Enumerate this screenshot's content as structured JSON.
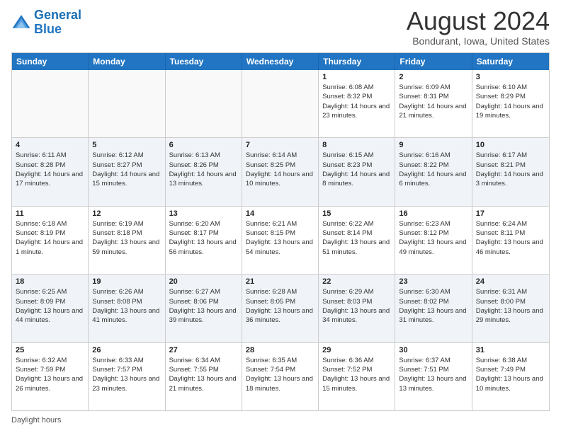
{
  "header": {
    "logo_line1": "General",
    "logo_line2": "Blue",
    "month_title": "August 2024",
    "location": "Bondurant, Iowa, United States"
  },
  "days_of_week": [
    "Sunday",
    "Monday",
    "Tuesday",
    "Wednesday",
    "Thursday",
    "Friday",
    "Saturday"
  ],
  "weeks": [
    [
      {
        "day": "",
        "info": ""
      },
      {
        "day": "",
        "info": ""
      },
      {
        "day": "",
        "info": ""
      },
      {
        "day": "",
        "info": ""
      },
      {
        "day": "1",
        "info": "Sunrise: 6:08 AM\nSunset: 8:32 PM\nDaylight: 14 hours and 23 minutes."
      },
      {
        "day": "2",
        "info": "Sunrise: 6:09 AM\nSunset: 8:31 PM\nDaylight: 14 hours and 21 minutes."
      },
      {
        "day": "3",
        "info": "Sunrise: 6:10 AM\nSunset: 8:29 PM\nDaylight: 14 hours and 19 minutes."
      }
    ],
    [
      {
        "day": "4",
        "info": "Sunrise: 6:11 AM\nSunset: 8:28 PM\nDaylight: 14 hours and 17 minutes."
      },
      {
        "day": "5",
        "info": "Sunrise: 6:12 AM\nSunset: 8:27 PM\nDaylight: 14 hours and 15 minutes."
      },
      {
        "day": "6",
        "info": "Sunrise: 6:13 AM\nSunset: 8:26 PM\nDaylight: 14 hours and 13 minutes."
      },
      {
        "day": "7",
        "info": "Sunrise: 6:14 AM\nSunset: 8:25 PM\nDaylight: 14 hours and 10 minutes."
      },
      {
        "day": "8",
        "info": "Sunrise: 6:15 AM\nSunset: 8:23 PM\nDaylight: 14 hours and 8 minutes."
      },
      {
        "day": "9",
        "info": "Sunrise: 6:16 AM\nSunset: 8:22 PM\nDaylight: 14 hours and 6 minutes."
      },
      {
        "day": "10",
        "info": "Sunrise: 6:17 AM\nSunset: 8:21 PM\nDaylight: 14 hours and 3 minutes."
      }
    ],
    [
      {
        "day": "11",
        "info": "Sunrise: 6:18 AM\nSunset: 8:19 PM\nDaylight: 14 hours and 1 minute."
      },
      {
        "day": "12",
        "info": "Sunrise: 6:19 AM\nSunset: 8:18 PM\nDaylight: 13 hours and 59 minutes."
      },
      {
        "day": "13",
        "info": "Sunrise: 6:20 AM\nSunset: 8:17 PM\nDaylight: 13 hours and 56 minutes."
      },
      {
        "day": "14",
        "info": "Sunrise: 6:21 AM\nSunset: 8:15 PM\nDaylight: 13 hours and 54 minutes."
      },
      {
        "day": "15",
        "info": "Sunrise: 6:22 AM\nSunset: 8:14 PM\nDaylight: 13 hours and 51 minutes."
      },
      {
        "day": "16",
        "info": "Sunrise: 6:23 AM\nSunset: 8:12 PM\nDaylight: 13 hours and 49 minutes."
      },
      {
        "day": "17",
        "info": "Sunrise: 6:24 AM\nSunset: 8:11 PM\nDaylight: 13 hours and 46 minutes."
      }
    ],
    [
      {
        "day": "18",
        "info": "Sunrise: 6:25 AM\nSunset: 8:09 PM\nDaylight: 13 hours and 44 minutes."
      },
      {
        "day": "19",
        "info": "Sunrise: 6:26 AM\nSunset: 8:08 PM\nDaylight: 13 hours and 41 minutes."
      },
      {
        "day": "20",
        "info": "Sunrise: 6:27 AM\nSunset: 8:06 PM\nDaylight: 13 hours and 39 minutes."
      },
      {
        "day": "21",
        "info": "Sunrise: 6:28 AM\nSunset: 8:05 PM\nDaylight: 13 hours and 36 minutes."
      },
      {
        "day": "22",
        "info": "Sunrise: 6:29 AM\nSunset: 8:03 PM\nDaylight: 13 hours and 34 minutes."
      },
      {
        "day": "23",
        "info": "Sunrise: 6:30 AM\nSunset: 8:02 PM\nDaylight: 13 hours and 31 minutes."
      },
      {
        "day": "24",
        "info": "Sunrise: 6:31 AM\nSunset: 8:00 PM\nDaylight: 13 hours and 29 minutes."
      }
    ],
    [
      {
        "day": "25",
        "info": "Sunrise: 6:32 AM\nSunset: 7:59 PM\nDaylight: 13 hours and 26 minutes."
      },
      {
        "day": "26",
        "info": "Sunrise: 6:33 AM\nSunset: 7:57 PM\nDaylight: 13 hours and 23 minutes."
      },
      {
        "day": "27",
        "info": "Sunrise: 6:34 AM\nSunset: 7:55 PM\nDaylight: 13 hours and 21 minutes."
      },
      {
        "day": "28",
        "info": "Sunrise: 6:35 AM\nSunset: 7:54 PM\nDaylight: 13 hours and 18 minutes."
      },
      {
        "day": "29",
        "info": "Sunrise: 6:36 AM\nSunset: 7:52 PM\nDaylight: 13 hours and 15 minutes."
      },
      {
        "day": "30",
        "info": "Sunrise: 6:37 AM\nSunset: 7:51 PM\nDaylight: 13 hours and 13 minutes."
      },
      {
        "day": "31",
        "info": "Sunrise: 6:38 AM\nSunset: 7:49 PM\nDaylight: 13 hours and 10 minutes."
      }
    ]
  ],
  "footer": {
    "note": "Daylight hours"
  }
}
